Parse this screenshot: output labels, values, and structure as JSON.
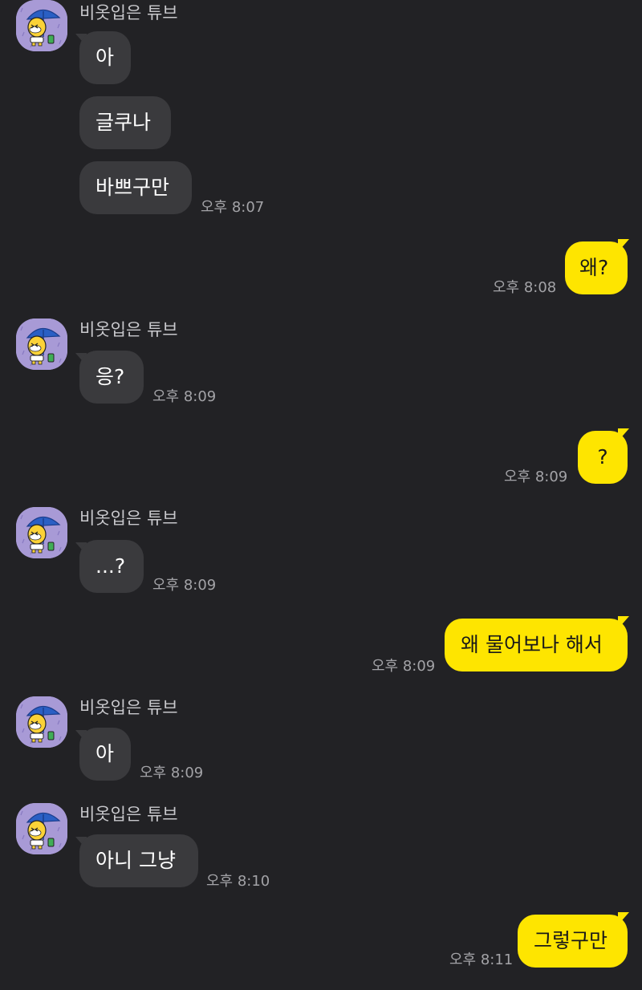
{
  "sender_name": "비옷입은 튜브",
  "avatar_icon": "tube-with-umbrella-avatar",
  "colors": {
    "background": "#222225",
    "incoming_bubble": "#3a3a3d",
    "outgoing_bubble": "#fee500",
    "timestamp": "#a3a3a7"
  },
  "messages": [
    {
      "dir": "in",
      "text": "아",
      "time": ""
    },
    {
      "dir": "in",
      "text": "글쿠나",
      "time": ""
    },
    {
      "dir": "in",
      "text": "바쁘구만",
      "time": "오후 8:07"
    },
    {
      "dir": "out",
      "text": "왜?",
      "time": "오후 8:08"
    },
    {
      "dir": "in",
      "text": "응?",
      "time": "오후 8:09"
    },
    {
      "dir": "out",
      "text": "?",
      "time": "오후 8:09"
    },
    {
      "dir": "in",
      "text": "...?",
      "time": "오후 8:09"
    },
    {
      "dir": "out",
      "text": "왜 물어보나 해서",
      "time": "오후 8:09"
    },
    {
      "dir": "in",
      "text": "아",
      "time": "오후 8:09"
    },
    {
      "dir": "in",
      "text": "아니 그냥",
      "time": "오후 8:10"
    },
    {
      "dir": "out",
      "text": "그렇구만",
      "time": "오후 8:11"
    }
  ]
}
